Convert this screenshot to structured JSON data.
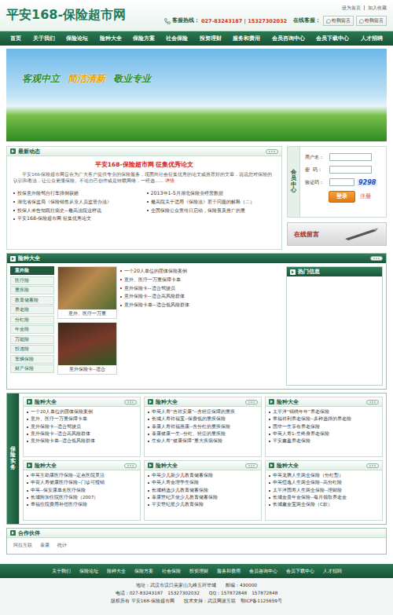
{
  "header": {
    "logo": "平安168-保险超市网",
    "top_links": [
      "设为首页",
      "加入收藏"
    ],
    "hotline_label": "客服热线：",
    "hotline": "027-83243187 | 15327302032",
    "online_label": "在线客服：",
    "online_buttons": [
      "给我留言",
      "给我留言"
    ]
  },
  "nav": [
    "首页",
    "关于我们",
    "保险论坛",
    "险种大全",
    "保险方案",
    "社会保险",
    "投资理财",
    "服务和费用",
    "会员咨询中心",
    "会员下载中心",
    "人才招聘"
  ],
  "banner": {
    "slogans": [
      {
        "text": "客观中立",
        "color": "#2a8c3a"
      },
      {
        "text": "简洁清新",
        "color": "#e6a500"
      },
      {
        "text": "敬业专业",
        "color": "#2a8c3a"
      }
    ]
  },
  "news": {
    "title": "最新动态",
    "headline": "平安168-保险超市网  征集优秀论文",
    "summary": "平安168-保险超市网旨在为广大客户提供专业的保险服务，现面向社会征集优秀的论文或推荐好的文章，说说您对保险的认识和看法，让公众更懂保险。不论自己创作或是转载网络，一经选……",
    "more_link": "详情",
    "items": [
      "投保意外险驾自行车摔倒获赔",
      "2013年1-5月湖北保险业经营数据",
      "湖北省保监局《保险销售从业人员监管办法》",
      "最高院关于适用《保险法》若干问题的解释（二）",
      "投保人未告知既往病史--最高法院这样说",
      "全国保险公众宣传日启动，保险普及推广的重",
      "平安168-保险超市网  征集优秀论文"
    ]
  },
  "member": {
    "title": "会员中心",
    "fields": [
      "用户名：",
      "密  码：",
      "验证码："
    ],
    "captcha": "9298",
    "login": "登录",
    "register": "注册"
  },
  "message_banner": {
    "title": "在线留言"
  },
  "insurance": {
    "title": "险种大全",
    "categories": [
      {
        "label": "意外险",
        "selected": true
      },
      {
        "label": "医疗险",
        "selected": false
      },
      {
        "label": "重疾险",
        "selected": false
      },
      {
        "label": "教育储蓄险",
        "selected": false
      },
      {
        "label": "养老险",
        "selected": false
      },
      {
        "label": "分红险",
        "selected": false
      },
      {
        "label": "年金险",
        "selected": false
      },
      {
        "label": "万能险",
        "selected": false
      },
      {
        "label": "投连险",
        "selected": false
      },
      {
        "label": "车辆保险",
        "selected": false
      },
      {
        "label": "财产保险",
        "selected": false
      }
    ],
    "pictures": [
      {
        "caption": "意外、医疗一万重"
      },
      {
        "caption": "意外保险卡--适合"
      }
    ],
    "items": [
      "一个20人单位的团体保险案例",
      "意外、医疗一万重保障卡单",
      "意外保险卡--适合驾驶员",
      "意外保险卡--适合高风险群体",
      "意外保险卡单--适合低风险群体"
    ],
    "hot_title": "热门信息"
  },
  "practice": {
    "title": "保险实务",
    "boxes": [
      {
        "title": "险种大全",
        "items": [
          "一个20人单位的团体保险案例",
          "意外、医疗一万重保障卡单",
          "意外保险卡--适合驾驶员",
          "意外保险卡--适合高风险群体",
          "意外保险卡单--适合低风险群体"
        ]
      },
      {
        "title": "险种大全",
        "items": [
          "中英人寿“吉祥安康”--含轻症保障的重疾",
          "长城人寿祥福宝--保费低的重疾保险",
          "泰康人寿祥福惠康--含分红的重疾保险",
          "泰康健康一生--分红、轻症的重疾险",
          "生命人寿“健康保障”重大疾病保险"
        ]
      },
      {
        "title": "险种大全",
        "items": [
          "太平洋“锦绣年年”养老保险",
          "幸福祥利养老保险--多种选择的养老险",
          "国华一生享有养老保险",
          "中英人寿1-生终身养老保险",
          "平安鑫盈养老保险"
        ]
      },
      {
        "title": "险种大全",
        "items": [
          "中英互助康医疗保险--定点医院灵活",
          "中荷人寿健康医疗保险--门诊可报销",
          "中英--保安康单名医疗保险",
          "长城附加住院医疗保险（2007）",
          "幸福住院费用补偿医疗保险"
        ]
      },
      {
        "title": "险种大全",
        "items": [
          "中英少儿新少儿教育储蓄保险",
          "中英人寿金理学生保险",
          "长城精选少儿教育储蓄保险",
          "泰康世纪天使少儿教育储蓄保险",
          "平安世纪星少儿教育保险"
        ]
      },
      {
        "title": "险种大全",
        "items": [
          "中英龙腾人生两全保险（分红型）",
          "中英恒逸人生两全保险--高分红险",
          "太平洋国寿人生两全保险--理财险",
          "长城金贵年金保险--每月领取养老金",
          "长城鑫金宝两全保险（C款）"
        ]
      }
    ]
  },
  "partners": {
    "title": "合作伙伴",
    "links": [
      "阿拉互联",
      "泰康",
      "统计"
    ]
  },
  "footer": {
    "nav": [
      "关于我们",
      "保险论坛",
      "险种大全",
      "保险方案",
      "社会保险",
      "投资理财",
      "服务和费用",
      "会员咨询中心",
      "会员下载中心",
      "人才招聘"
    ],
    "lines": [
      "地址：武汉市汉口吴家山九峰五环华城　　邮编：430000",
      "电话：027-83243187　15327302032　　QQ：157872848　157872848",
      "版权所有 平安168-保险超市网　　技术支持：武汉网派互联　鄂ICP备1125659号"
    ]
  }
}
